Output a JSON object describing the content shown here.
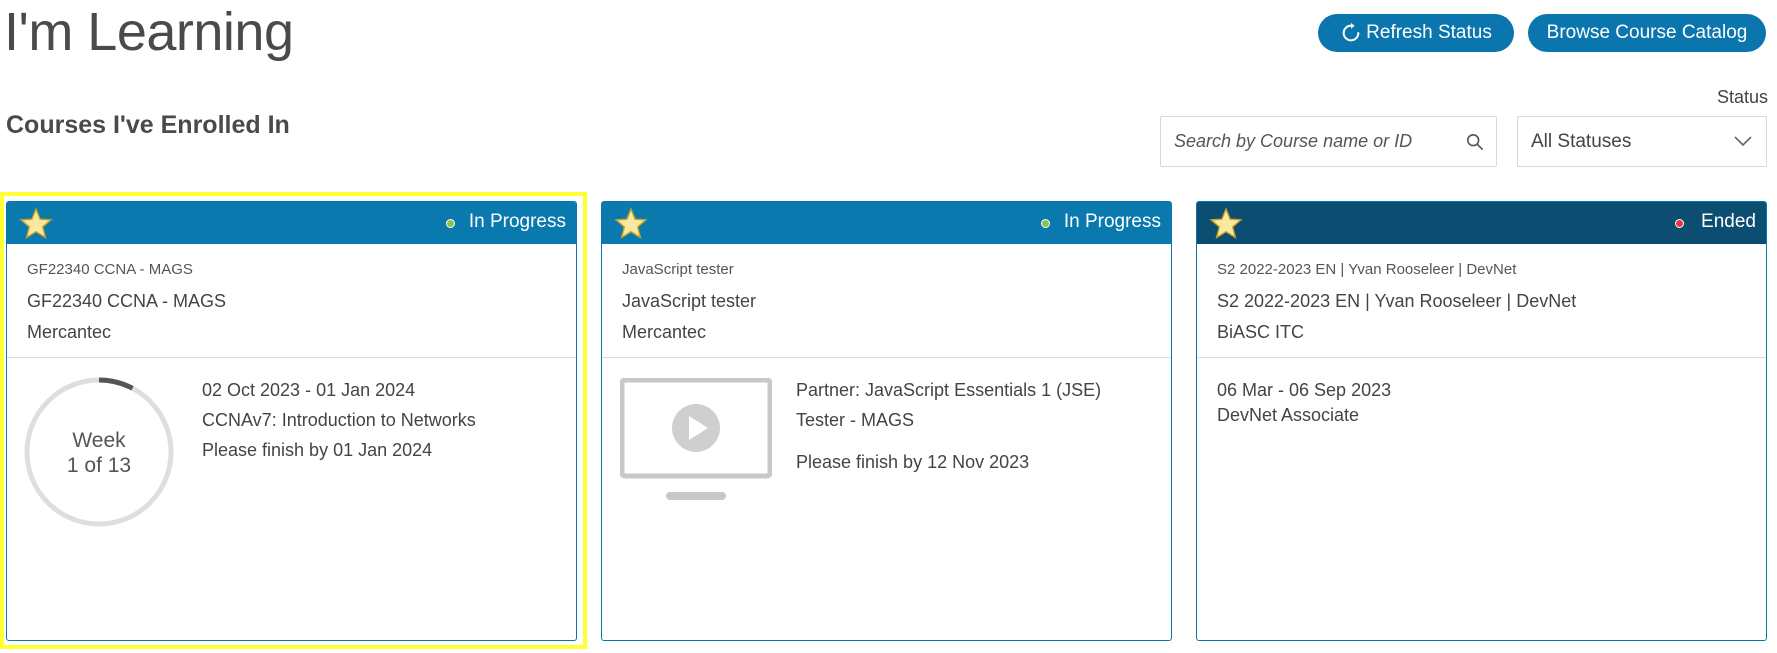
{
  "header": {
    "title": "I'm Learning",
    "refresh_label": "Refresh Status",
    "catalog_label": "Browse Course Catalog"
  },
  "section": {
    "title": "Courses I've Enrolled In"
  },
  "search": {
    "placeholder": "Search by Course name or ID",
    "value": ""
  },
  "status_filter": {
    "label": "Status",
    "selected": "All Statuses"
  },
  "colors": {
    "accent": "#0a76ad",
    "header_active": "#0a7aae",
    "header_ended": "#0b4e72",
    "status_in_progress": "#8bc34a",
    "status_ended": "#e53935",
    "highlight": "#ffff33"
  },
  "cards": [
    {
      "status": "In Progress",
      "course_id": "GF22340 CCNA - MAGS",
      "course_name": "GF22340 CCNA - MAGS",
      "org": "Mercantec",
      "progress": {
        "label": "Week",
        "value": "1 of 13",
        "fraction": 0.077
      },
      "dates": "02 Oct 2023 - 01 Jan 2024",
      "course_title": "CCNAv7: Introduction to Networks",
      "finish_by": "Please finish by 01 Jan 2024"
    },
    {
      "status": "In Progress",
      "course_id": "JavaScript tester",
      "course_name": "JavaScript tester",
      "org": "Mercantec",
      "partner": "Partner: JavaScript Essentials 1 (JSE)",
      "tester": "Tester - MAGS",
      "finish_by": "Please finish by 12 Nov 2023"
    },
    {
      "status": "Ended",
      "course_id": "S2 2022-2023 EN | Yvan Rooseleer | DevNet",
      "course_name": "S2 2022-2023 EN | Yvan Rooseleer | DevNet",
      "org": "BiASC ITC",
      "dates": "06 Mar - 06 Sep 2023",
      "course_title": "DevNet Associate"
    }
  ]
}
